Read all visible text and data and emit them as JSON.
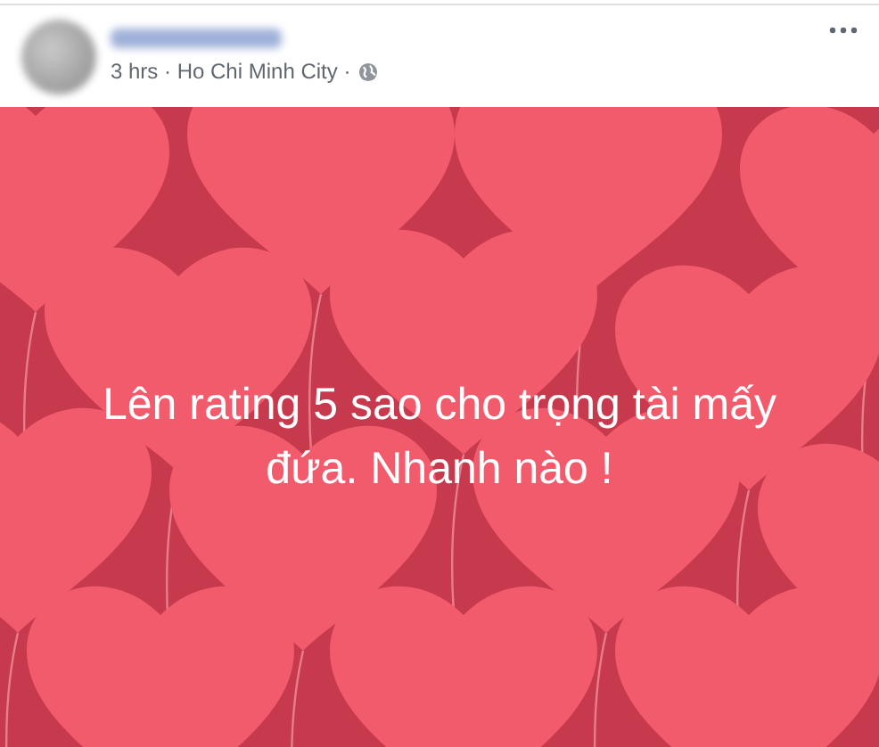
{
  "post": {
    "meta": "3 hrs · Ho Chi Minh City ·",
    "text": "Lên rating 5 sao cho trọng tài mấy đứa. Nhanh nào !"
  }
}
